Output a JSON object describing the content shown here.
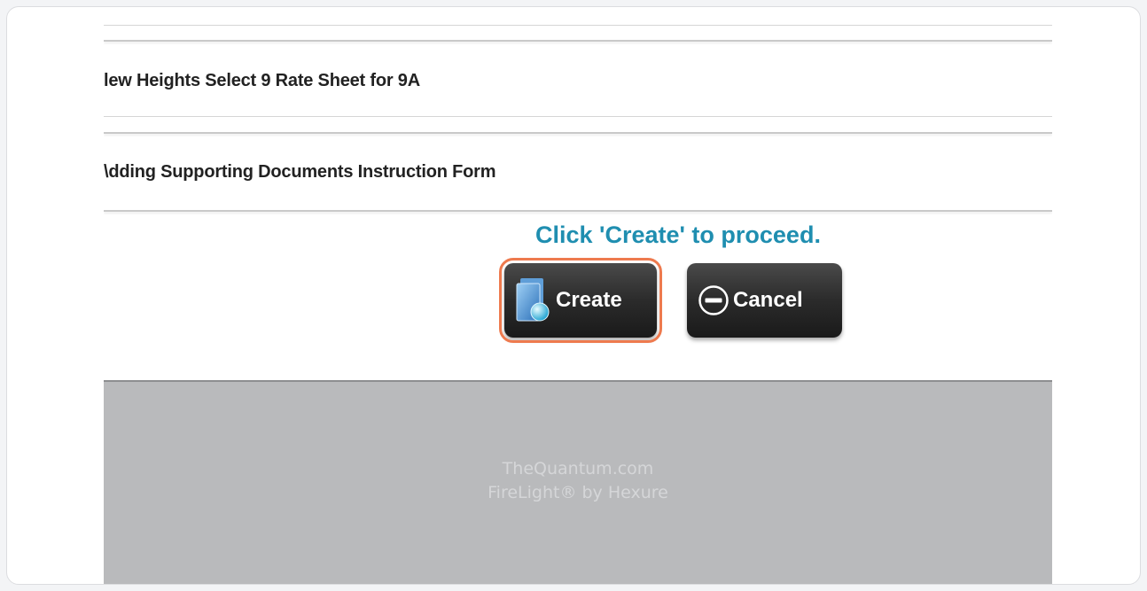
{
  "documents": {
    "row1": "lew Heights Select 9 Rate Sheet for 9A",
    "row2": "\\dding Supporting Documents Instruction Form"
  },
  "prompt_text": "Click 'Create' to proceed.",
  "buttons": {
    "create_label": "Create",
    "cancel_label": "Cancel"
  },
  "footer": {
    "line1": "TheQuantum.com",
    "line2": "FireLight® by Hexure"
  },
  "colors": {
    "prompt": "#1f8eb0",
    "highlight": "#ee7a4e",
    "footer_bg": "#b9babc"
  },
  "icons": {
    "create": "document-globe-icon",
    "cancel": "minus-circle-icon"
  }
}
